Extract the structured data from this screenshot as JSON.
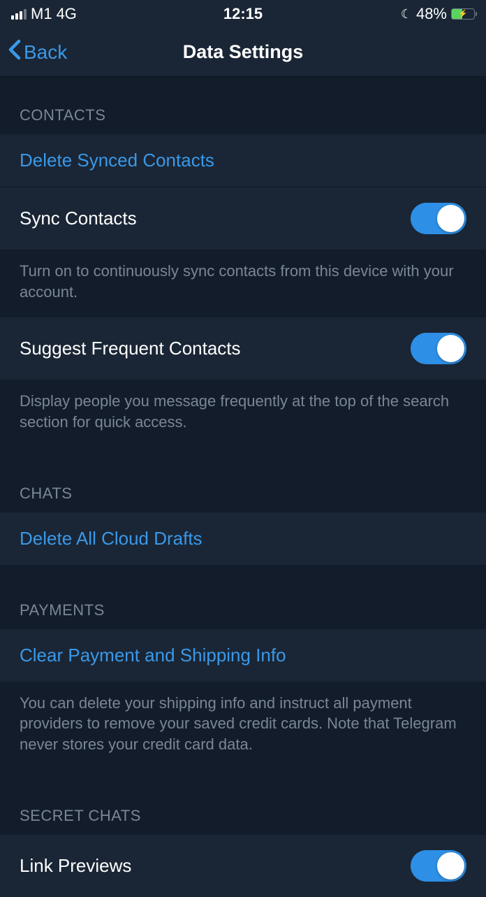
{
  "statusBar": {
    "carrier": "M1",
    "network": "4G",
    "time": "12:15",
    "batteryPercent": "48%"
  },
  "nav": {
    "backLabel": "Back",
    "title": "Data Settings"
  },
  "sections": {
    "contacts": {
      "header": "CONTACTS",
      "deleteSynced": "Delete Synced Contacts",
      "syncContacts": "Sync Contacts",
      "syncFooter": "Turn on to continuously sync contacts from this device with your account.",
      "suggestFrequent": "Suggest Frequent Contacts",
      "suggestFooter": "Display people you message frequently at the top of the search section for quick access."
    },
    "chats": {
      "header": "CHATS",
      "deleteDrafts": "Delete All Cloud Drafts"
    },
    "payments": {
      "header": "PAYMENTS",
      "clearPayment": "Clear Payment and Shipping Info",
      "footer": "You can delete your shipping info and instruct all payment providers to remove your saved credit cards. Note that Telegram never stores your credit card data."
    },
    "secretChats": {
      "header": "SECRET CHATS",
      "linkPreviews": "Link Previews"
    }
  }
}
